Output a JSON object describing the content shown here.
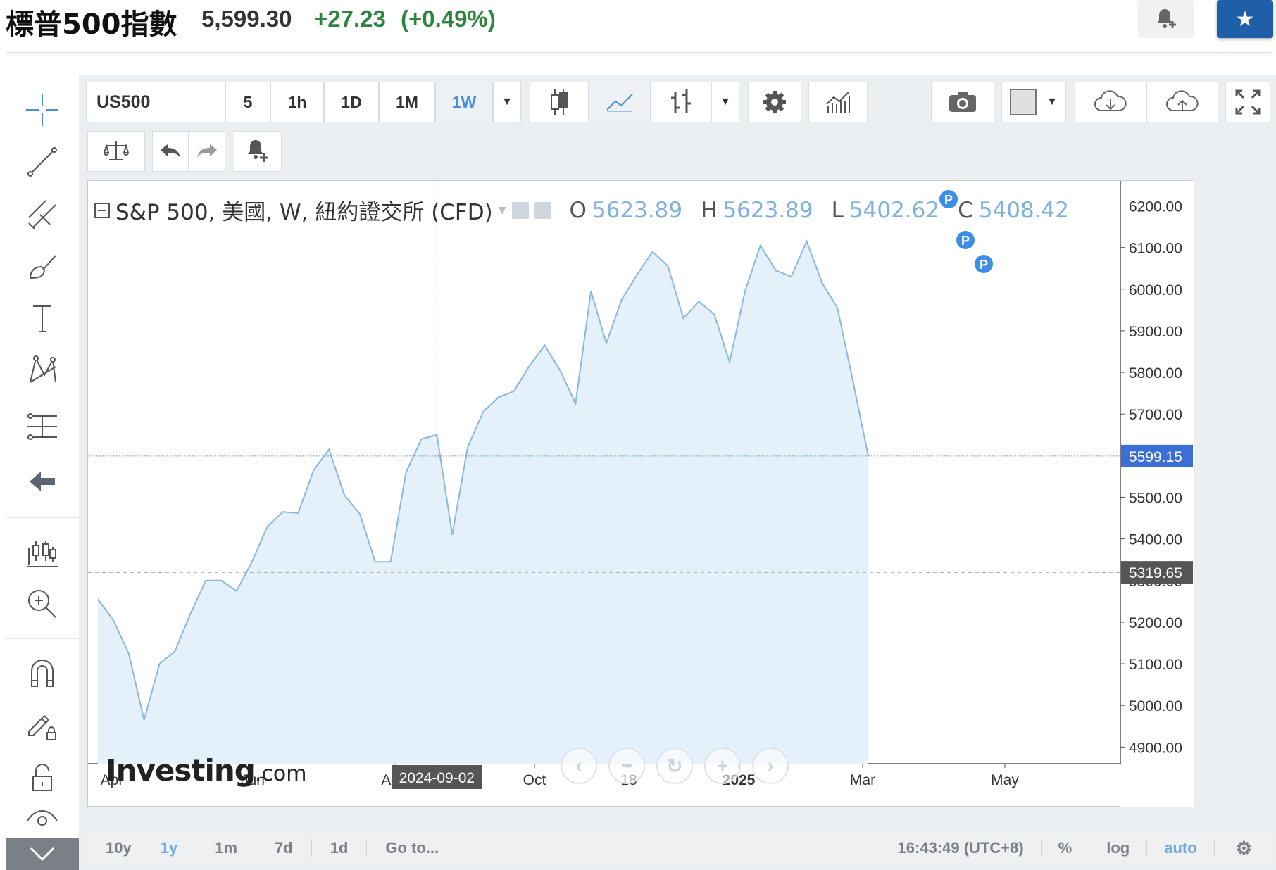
{
  "header": {
    "title": "標普500指數",
    "price": "5,599.30",
    "change": "+27.23",
    "change_pct": "(+0.49%)"
  },
  "toolbar": {
    "symbol": "US500",
    "intervals": [
      "5",
      "1h",
      "1D",
      "1M",
      "1W"
    ],
    "active_interval": "1W"
  },
  "legend": {
    "title": "S&P 500, 美國, W, 紐約證交所 (CFD)",
    "open_label": "O",
    "open": "5623.89",
    "high_label": "H",
    "high": "5623.89",
    "low_label": "L",
    "low": "5402.62",
    "close_label": "C",
    "close": "5408.42"
  },
  "brand": {
    "name": "Investing",
    "suffix": ".com"
  },
  "bottom_bar": {
    "ranges": [
      "10y",
      "1y",
      "1m",
      "7d",
      "1d"
    ],
    "active_range": "1y",
    "goto": "Go to...",
    "time": "16:43:49 (UTC+8)",
    "percent": "%",
    "log": "log",
    "auto": "auto"
  },
  "colors": {
    "line": "#8ab6e0",
    "area": "#e5f1fa",
    "accent": "#4a90d9",
    "last_price_label": "#3b6fd4",
    "crosshair_label": "#555555",
    "up": "#2e8540"
  },
  "chart_data": {
    "type": "area",
    "title": "S&P 500, 美國, W, 紐約證交所 (CFD)",
    "xlabel": "",
    "ylabel": "",
    "ylim": [
      4860,
      6260
    ],
    "y_ticks": [
      "6200.00",
      "6100.00",
      "6000.00",
      "5900.00",
      "5800.00",
      "5700.00",
      "5600.00",
      "5500.00",
      "5400.00",
      "5300.00",
      "5200.00",
      "5100.00",
      "5000.00",
      "4900.00"
    ],
    "x_tick_labels": [
      "Apr",
      "Jun",
      "Aug",
      "Oct",
      "18",
      "2025",
      "Mar",
      "May"
    ],
    "crosshair_x_label": "2024-09-02",
    "crosshair_y_label": "5319.65",
    "last_price_label": "5599.15",
    "series": [
      {
        "values": [
          5255,
          5205,
          5125,
          4965,
          5100,
          5130,
          5220,
          5300,
          5300,
          5275,
          5345,
          5430,
          5465,
          5462,
          5565,
          5615,
          5505,
          5460,
          5345,
          5345,
          5560,
          5640,
          5650,
          5410,
          5620,
          5705,
          5740,
          5755,
          5815,
          5865,
          5805,
          5725,
          5995,
          5870,
          5975,
          6035,
          6090,
          6055,
          5930,
          5970,
          5940,
          5825,
          5995,
          6105,
          6045,
          6030,
          6115,
          6015,
          5955,
          5780,
          5599
        ]
      }
    ],
    "markers": [
      "P",
      "P",
      "P"
    ],
    "grid": false
  }
}
